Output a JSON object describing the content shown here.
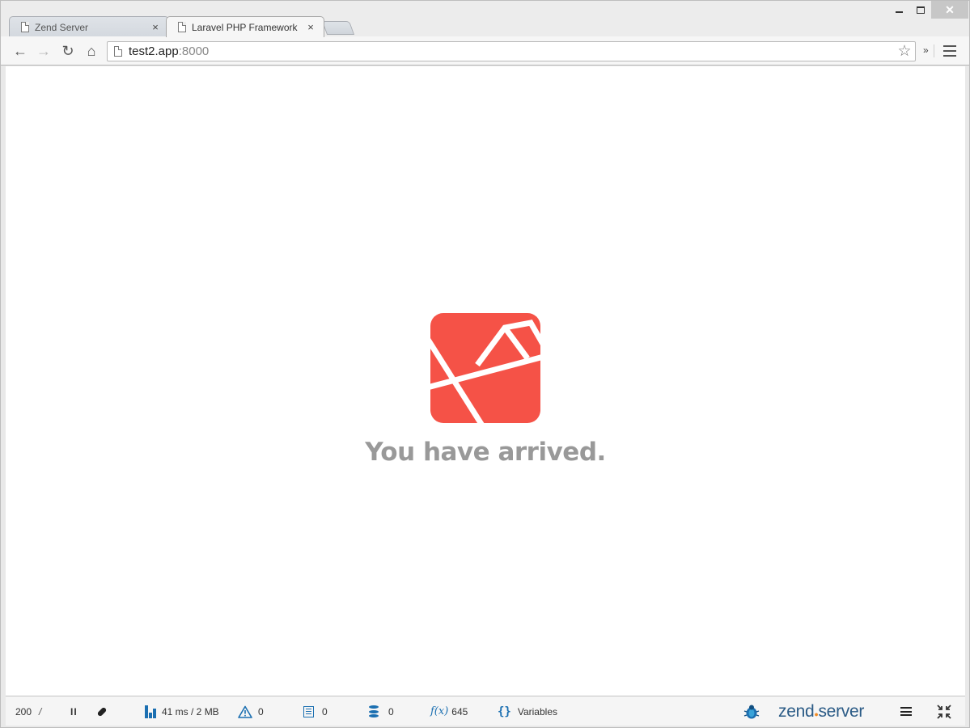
{
  "window": {
    "tabs": [
      {
        "title": "Zend Server",
        "close": "×",
        "active": false
      },
      {
        "title": "Laravel PHP Framework",
        "close": "×",
        "active": true
      }
    ],
    "controls": {
      "close": "✕"
    }
  },
  "toolbar": {
    "back_icon": "←",
    "forward_icon": "→",
    "reload_icon": "↻",
    "home_icon": "⌂",
    "url_host": "test2.app",
    "url_port": ":8000",
    "bookmark_icon": "☆",
    "extensions_label": "»"
  },
  "page": {
    "logo": "laravel-logo",
    "logo_color": "#f55247",
    "heading": "You have arrived."
  },
  "zend_bar": {
    "status_code": "200",
    "status_separator": "/",
    "pause_label": "II",
    "time_memory": "41 ms / 2 MB",
    "warnings_count": "0",
    "logs_count": "0",
    "queries_count": "0",
    "functions_label": "f(x)",
    "functions_count": "645",
    "variables_brace": "{}",
    "variables_label": "Variables",
    "brand_zend": "zend",
    "brand_server": "server",
    "accent_color": "#1b6fb1"
  }
}
